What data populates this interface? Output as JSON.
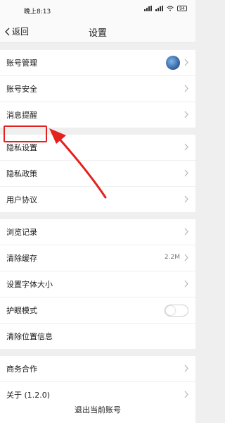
{
  "status_bar": {
    "time": "晚上8:13",
    "battery": "94"
  },
  "nav": {
    "back_label": "返回",
    "title": "设置"
  },
  "groups": [
    {
      "items": [
        {
          "label": "账号管理",
          "has_avatar": true
        },
        {
          "label": "账号安全"
        },
        {
          "label": "消息提醒"
        }
      ]
    },
    {
      "items": [
        {
          "label": "隐私设置",
          "highlighted": true
        },
        {
          "label": "隐私政策"
        },
        {
          "label": "用户协议"
        }
      ]
    },
    {
      "items": [
        {
          "label": "浏览记录"
        },
        {
          "label": "清除缓存",
          "value": "2.2M"
        },
        {
          "label": "设置字体大小"
        },
        {
          "label": "护眼模式",
          "toggle": false
        },
        {
          "label": "清除位置信息"
        }
      ]
    },
    {
      "items": [
        {
          "label": "商务合作"
        },
        {
          "label": "关于 (1.2.0)"
        }
      ]
    }
  ],
  "logout_label": "退出当前账号",
  "colors": {
    "annotation": "#e3211e",
    "background": "#efefef"
  }
}
